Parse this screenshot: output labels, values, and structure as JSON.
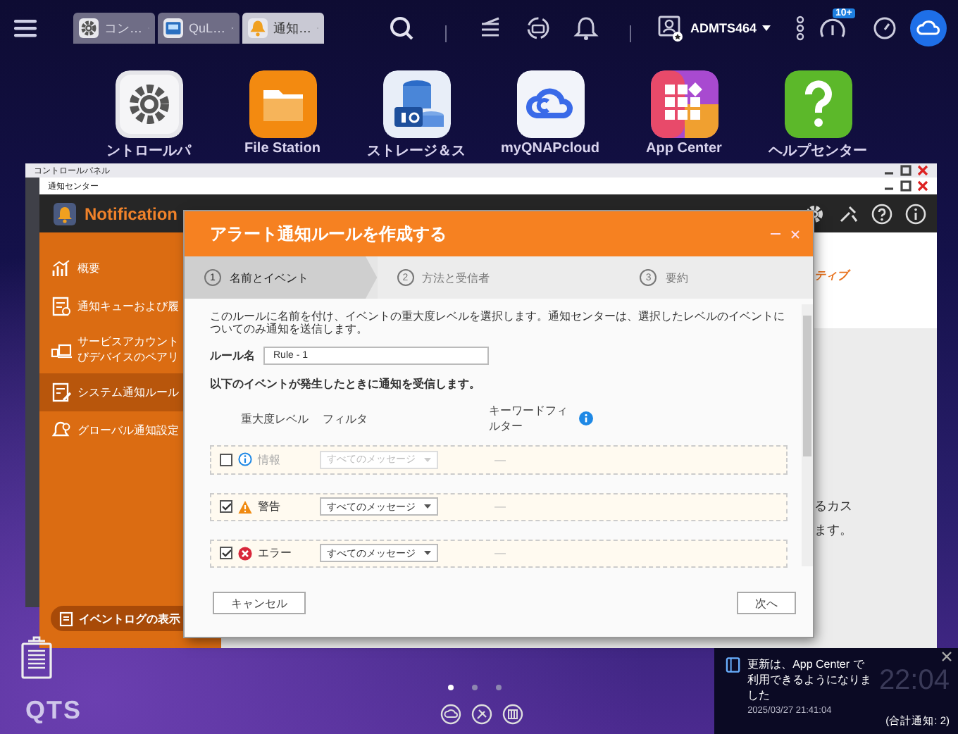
{
  "top_bar": {
    "tabs": [
      {
        "label": "コン…",
        "kind": "gear",
        "selected": false
      },
      {
        "label": "QuL…",
        "kind": "screen",
        "selected": false
      },
      {
        "label": "通知…",
        "kind": "bell",
        "selected": true
      }
    ],
    "user": "ADMTS464",
    "badge": "10+"
  },
  "desktop_icons": [
    {
      "label": "ントロールパ",
      "kind": "gear"
    },
    {
      "label": "File Station",
      "kind": "folder"
    },
    {
      "label": "ストレージ＆ス",
      "kind": "storage"
    },
    {
      "label": "myQNAPcloud",
      "kind": "cloud"
    },
    {
      "label": "App Center",
      "kind": "apps"
    },
    {
      "label": "ヘルプセンター",
      "kind": "help"
    }
  ],
  "control_panel": {
    "title": "コントロールパネル"
  },
  "notification_center": {
    "title": "通知センター",
    "app_name": "Notification",
    "sidebar": [
      {
        "lines": [
          "概要"
        ],
        "kind": "chart",
        "selected": false
      },
      {
        "lines": [
          "通知キューおよび履"
        ],
        "kind": "queue",
        "selected": false
      },
      {
        "lines": [
          "サービスアカウント",
          "びデバイスのペアリ"
        ],
        "kind": "device",
        "selected": false
      },
      {
        "lines": [
          "システム通知ルール"
        ],
        "kind": "rule",
        "selected": true
      },
      {
        "lines": [
          "グローバル通知設定"
        ],
        "kind": "global",
        "selected": false
      }
    ],
    "log_button": "イベントログの表示",
    "active_text": "ティブ",
    "content_lines": [
      "るカス",
      "ます。"
    ]
  },
  "dialog": {
    "title": "アラート通知ルールを作成する",
    "steps": [
      {
        "number": "1",
        "label": "名前とイベント",
        "selected": true
      },
      {
        "number": "2",
        "label": "方法と受信者",
        "selected": false
      },
      {
        "number": "3",
        "label": "要約",
        "selected": false
      }
    ],
    "description": "このルールに名前を付け、イベントの重大度レベルを選択します。通知センターは、選択したレベルのイベントについてのみ通知を送信します。",
    "rule_name_label": "ルール名",
    "rule_name": "Rule - 1",
    "events_intro": "以下のイベントが発生したときに通知を受信します。",
    "columns": [
      "重大度レベル",
      "フィルタ",
      "キーワードフィルター"
    ],
    "levels": [
      {
        "kind": "info",
        "label": "情報",
        "checked": false,
        "filter": "すべてのメッセージ",
        "keyword": "—"
      },
      {
        "kind": "warning",
        "label": "警告",
        "checked": true,
        "filter": "すべてのメッセージ",
        "keyword": "—"
      },
      {
        "kind": "error",
        "label": "エラー",
        "checked": true,
        "filter": "すべてのメッセージ",
        "keyword": "—"
      }
    ],
    "buttons": [
      "キャンセル",
      "次へ"
    ]
  },
  "desktop": {
    "logo": "QTS",
    "pages": [
      {
        "selected": true
      },
      {
        "selected": false
      },
      {
        "selected": false
      }
    ]
  },
  "notification_popup": {
    "message": "更新は、App Center で利用できるようになりました",
    "time": "2025/03/27 21:41:04",
    "total": "(合計通知: 2)"
  },
  "clock": "22:04"
}
